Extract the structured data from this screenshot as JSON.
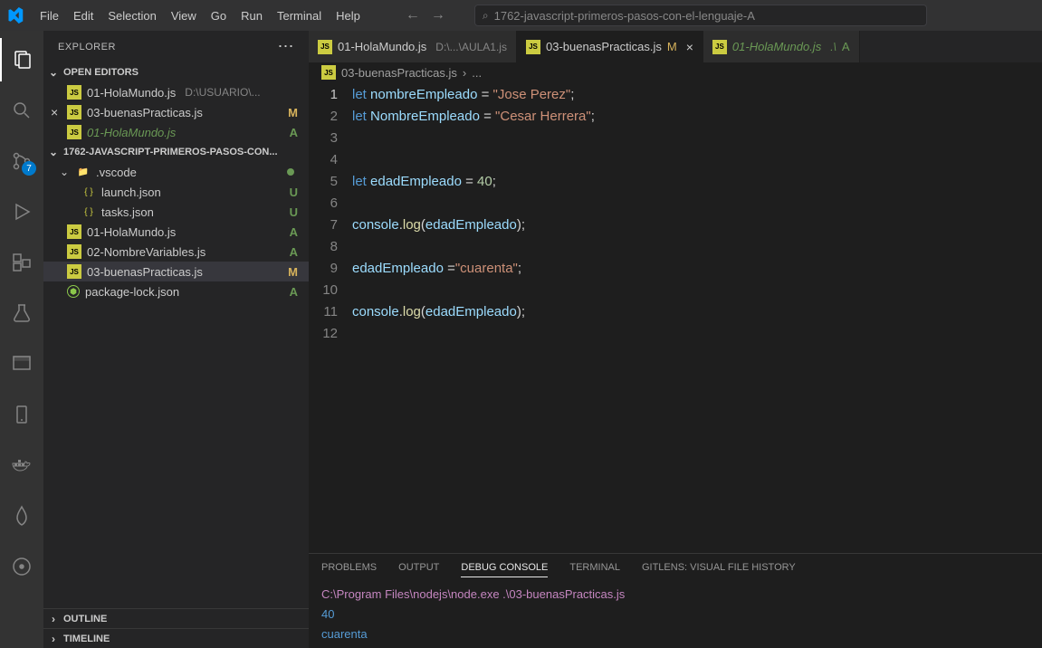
{
  "menu": [
    "File",
    "Edit",
    "Selection",
    "View",
    "Go",
    "Run",
    "Terminal",
    "Help"
  ],
  "search_placeholder": "1762-javascript-primeros-pasos-con-el-lenguaje-A",
  "activity_badge": "7",
  "explorer": {
    "title": "EXPLORER",
    "open_editors_label": "OPEN EDITORS",
    "open_editors": [
      {
        "name": "01-HolaMundo.js",
        "path": "D:\\USUARIO\\...",
        "status": ""
      },
      {
        "name": "03-buenasPracticas.js",
        "path": "",
        "status": "M",
        "active": true
      },
      {
        "name": "01-HolaMundo.js",
        "path": "",
        "status": "A",
        "italic": true
      }
    ],
    "workspace_label": "1762-JAVASCRIPT-PRIMEROS-PASOS-CON...",
    "tree": [
      {
        "type": "folder",
        "name": ".vscode",
        "dot": true
      },
      {
        "type": "file",
        "name": "launch.json",
        "status": "U",
        "icon": "json",
        "indent": 1
      },
      {
        "type": "file",
        "name": "tasks.json",
        "status": "U",
        "icon": "json",
        "indent": 1
      },
      {
        "type": "file",
        "name": "01-HolaMundo.js",
        "status": "A",
        "icon": "js"
      },
      {
        "type": "file",
        "name": "02-NombreVariables.js",
        "status": "A",
        "icon": "js"
      },
      {
        "type": "file",
        "name": "03-buenasPracticas.js",
        "status": "M",
        "icon": "js",
        "selected": true
      },
      {
        "type": "file",
        "name": "package-lock.json",
        "status": "A",
        "icon": "node"
      }
    ],
    "outline_label": "OUTLINE",
    "timeline_label": "TIMELINE"
  },
  "tabs": [
    {
      "name": "01-HolaMundo.js",
      "path": "D:\\...\\AULA1.js",
      "status": "",
      "icon": "js"
    },
    {
      "name": "03-buenasPracticas.js",
      "status": "M",
      "icon": "js",
      "active": true
    },
    {
      "name": "01-HolaMundo.js",
      "path": ".\\",
      "status": "A",
      "icon": "js",
      "italic": true
    }
  ],
  "breadcrumb": {
    "file": "03-buenasPracticas.js",
    "rest": "..."
  },
  "code_lines": [
    {
      "n": 1,
      "tokens": [
        [
          "kw",
          "let"
        ],
        [
          "sp",
          " "
        ],
        [
          "var",
          "nombreEmpleado"
        ],
        [
          "op",
          " = "
        ],
        [
          "str",
          "\"Jose Perez\""
        ],
        [
          "pun",
          ";"
        ]
      ]
    },
    {
      "n": 2,
      "tokens": [
        [
          "kw",
          "let"
        ],
        [
          "sp",
          " "
        ],
        [
          "var",
          "NombreEmpleado"
        ],
        [
          "op",
          " = "
        ],
        [
          "str",
          "\"Cesar Herrera\""
        ],
        [
          "pun",
          ";"
        ]
      ]
    },
    {
      "n": 3,
      "tokens": []
    },
    {
      "n": 4,
      "tokens": []
    },
    {
      "n": 5,
      "tokens": [
        [
          "kw",
          "let"
        ],
        [
          "sp",
          " "
        ],
        [
          "var",
          "edadEmpleado"
        ],
        [
          "op",
          " = "
        ],
        [
          "num",
          "40"
        ],
        [
          "pun",
          ";"
        ]
      ]
    },
    {
      "n": 6,
      "tokens": []
    },
    {
      "n": 7,
      "tokens": [
        [
          "obj",
          "console"
        ],
        [
          "pun",
          "."
        ],
        [
          "fn",
          "log"
        ],
        [
          "pun",
          "("
        ],
        [
          "var",
          "edadEmpleado"
        ],
        [
          "pun",
          ")"
        ],
        [
          "pun",
          ";"
        ]
      ]
    },
    {
      "n": 8,
      "tokens": []
    },
    {
      "n": 9,
      "tokens": [
        [
          "var",
          "edadEmpleado"
        ],
        [
          "op",
          " ="
        ],
        [
          "str",
          "\"cuarenta\""
        ],
        [
          "pun",
          ";"
        ]
      ]
    },
    {
      "n": 10,
      "tokens": []
    },
    {
      "n": 11,
      "tokens": [
        [
          "obj",
          "console"
        ],
        [
          "pun",
          "."
        ],
        [
          "fn",
          "log"
        ],
        [
          "pun",
          "("
        ],
        [
          "var",
          "edadEmpleado"
        ],
        [
          "pun",
          ")"
        ],
        [
          "pun",
          ";"
        ]
      ]
    },
    {
      "n": 12,
      "tokens": []
    }
  ],
  "panel_tabs": [
    "PROBLEMS",
    "OUTPUT",
    "DEBUG CONSOLE",
    "TERMINAL",
    "GITLENS: VISUAL FILE HISTORY"
  ],
  "panel_active": "DEBUG CONSOLE",
  "console": [
    {
      "cls": "console-path",
      "text": "C:\\Program Files\\nodejs\\node.exe .\\03-buenasPracticas.js"
    },
    {
      "cls": "console-val",
      "text": "40"
    },
    {
      "cls": "console-val",
      "text": "cuarenta"
    }
  ]
}
